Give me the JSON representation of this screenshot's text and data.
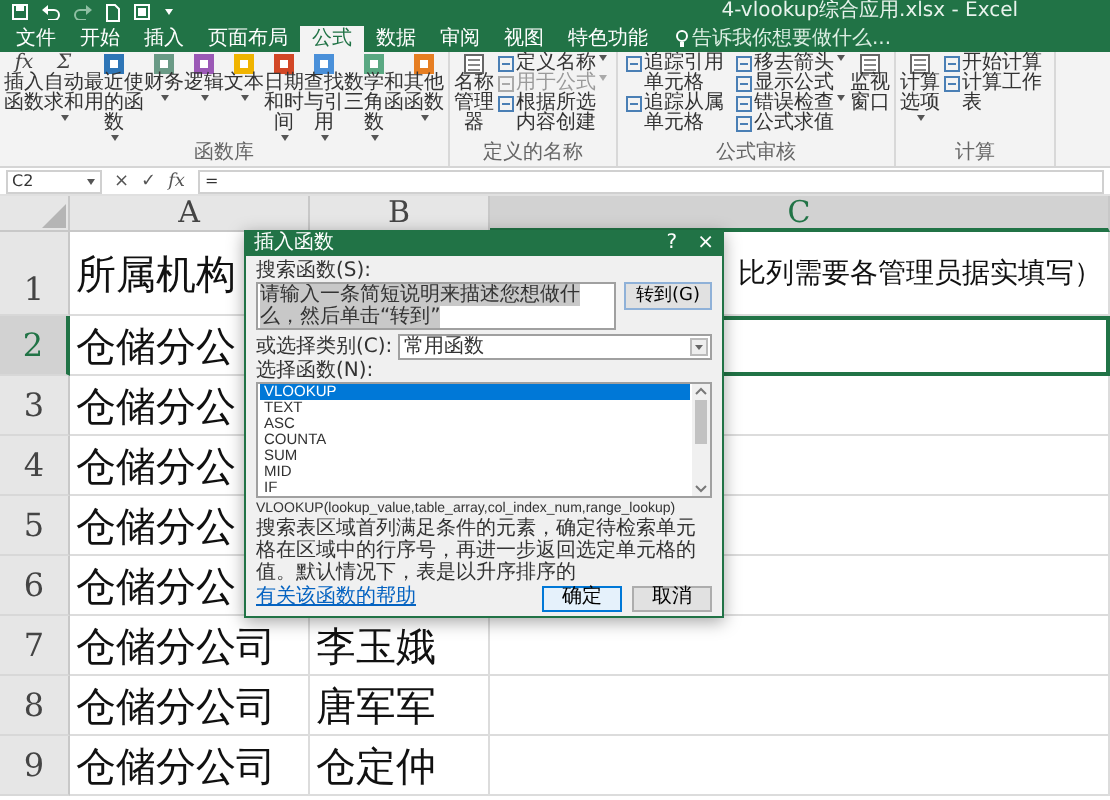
{
  "window": {
    "title": "4-vlookup综合应用.xlsx - Excel"
  },
  "tabs": [
    {
      "label": "文件",
      "selected": false
    },
    {
      "label": "开始",
      "selected": false
    },
    {
      "label": "插入",
      "selected": false
    },
    {
      "label": "页面布局",
      "selected": false
    },
    {
      "label": "公式",
      "selected": true
    },
    {
      "label": "数据",
      "selected": false
    },
    {
      "label": "审阅",
      "selected": false
    },
    {
      "label": "视图",
      "selected": false
    },
    {
      "label": "特色功能",
      "selected": false
    }
  ],
  "tell_me": {
    "placeholder": "告诉我你想要做什么..."
  },
  "ribbon_groups": [
    {
      "label": "函数库",
      "items": [
        {
          "kind": "large",
          "label": "插入函数",
          "glyph": "fx",
          "dropdown": false
        },
        {
          "kind": "large",
          "label": "自动求和",
          "glyph": "Σ",
          "dropdown": true
        },
        {
          "kind": "large",
          "label": "最近使用的函数",
          "color": "#2e75b6",
          "dropdown": true
        },
        {
          "kind": "large",
          "label": "财务",
          "color": "#6a9a86",
          "dropdown": true
        },
        {
          "kind": "large",
          "label": "逻辑",
          "color": "#9b59b6",
          "dropdown": true
        },
        {
          "kind": "large",
          "label": "文本",
          "color": "#f0b400",
          "dropdown": true
        },
        {
          "kind": "large",
          "label": "日期和时间",
          "color": "#d24726",
          "dropdown": true
        },
        {
          "kind": "large",
          "label": "查找与引用",
          "color": "#4a90d9",
          "dropdown": true
        },
        {
          "kind": "large",
          "label": "数学和三角函数",
          "color": "#5aa882",
          "dropdown": true
        },
        {
          "kind": "large",
          "label": "其他函数",
          "color": "#e67e22",
          "dropdown": true
        }
      ]
    },
    {
      "label": "定义的名称",
      "items": [
        {
          "kind": "large",
          "label": "名称管理器",
          "dropdown": false
        },
        {
          "kind": "small",
          "label": "定义名称",
          "dropdown": true,
          "disabled": false
        },
        {
          "kind": "small",
          "label": "用于公式",
          "dropdown": true,
          "disabled": true
        },
        {
          "kind": "small",
          "label": "根据所选内容创建",
          "dropdown": false,
          "disabled": false
        }
      ]
    },
    {
      "label": "公式审核",
      "items": [
        {
          "kind": "small",
          "label": "追踪引用单元格",
          "dropdown": false,
          "disabled": false
        },
        {
          "kind": "small",
          "label": "追踪从属单元格",
          "dropdown": false,
          "disabled": false
        },
        {
          "kind": "small",
          "label": "移去箭头",
          "dropdown": true,
          "disabled": false
        },
        {
          "kind": "small",
          "label": "显示公式",
          "dropdown": false,
          "disabled": false
        },
        {
          "kind": "small",
          "label": "错误检查",
          "dropdown": true,
          "disabled": false
        },
        {
          "kind": "small",
          "label": "公式求值",
          "dropdown": false,
          "disabled": false
        },
        {
          "kind": "large",
          "label": "监视窗口",
          "dropdown": false
        }
      ]
    },
    {
      "label": "计算",
      "items": [
        {
          "kind": "large",
          "label": "计算选项",
          "dropdown": true
        },
        {
          "kind": "small",
          "label": "开始计算",
          "dropdown": false,
          "disabled": false
        },
        {
          "kind": "small",
          "label": "计算工作表",
          "dropdown": false,
          "disabled": false
        }
      ]
    }
  ],
  "formula_bar": {
    "name_box": "C2",
    "cancel": "×",
    "enter": "✓",
    "fx": "fx",
    "formula": "="
  },
  "sheet": {
    "columns": [
      {
        "label": "A",
        "selected": false
      },
      {
        "label": "B",
        "selected": false
      },
      {
        "label": "C",
        "selected": true
      }
    ],
    "rows": [
      {
        "number": "1",
        "selected": false,
        "a": "所属机构",
        "c": "比列需要各管理员据实填写）"
      },
      {
        "number": "2",
        "selected": true,
        "a": "仓储分公"
      },
      {
        "number": "3",
        "selected": false,
        "a": "仓储分公"
      },
      {
        "number": "4",
        "selected": false,
        "a": "仓储分公"
      },
      {
        "number": "5",
        "selected": false,
        "a": "仓储分公"
      },
      {
        "number": "6",
        "selected": false,
        "a": "仓储分公"
      },
      {
        "number": "7",
        "selected": false,
        "a": "仓储分公司",
        "b": "李玉娥"
      },
      {
        "number": "8",
        "selected": false,
        "a": "仓储分公司",
        "b": "唐军军"
      },
      {
        "number": "9",
        "selected": false,
        "a": "仓储分公司",
        "b": "仓定仲"
      }
    ]
  },
  "dialog": {
    "title": "插入函数",
    "help": "?",
    "close": "×",
    "search_label": "搜索函数(S):",
    "search_value": "请输入一条简短说明来描述您想做什么，然后单击“转到”",
    "search_selected": true,
    "go_button": "转到(G)",
    "category_label": "或选择类别(C):",
    "category_value": "常用函数",
    "function_list_label": "选择函数(N):",
    "functions": [
      {
        "name": "VLOOKUP",
        "selected": true
      },
      {
        "name": "TEXT",
        "selected": false
      },
      {
        "name": "ASC",
        "selected": false
      },
      {
        "name": "COUNTA",
        "selected": false
      },
      {
        "name": "SUM",
        "selected": false
      },
      {
        "name": "MID",
        "selected": false
      },
      {
        "name": "IF",
        "selected": false
      }
    ],
    "syntax": "VLOOKUP(lookup_value,table_array,col_index_num,range_lookup)",
    "description": "搜索表区域首列满足条件的元素，确定待检索单元格在区域中的行序号，再进一步返回选定单元格的值。默认情况下，表是以升序排序的",
    "help_link": "有关该函数的帮助",
    "buttons": [
      {
        "label": "确定",
        "default": true
      },
      {
        "label": "取消",
        "default": false
      }
    ]
  }
}
